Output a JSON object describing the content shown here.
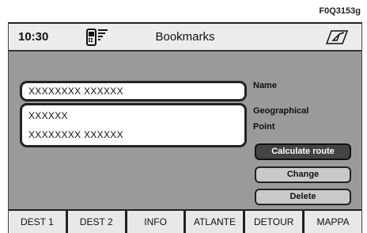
{
  "figure_code": "F0Q3153g",
  "header": {
    "time": "10:30",
    "title": "Bookmarks",
    "phone_icon": "phone-signal-icon",
    "nav_icon": "navigation-map-icon"
  },
  "fields": {
    "name_value": "XXXXXXXX XXXXXX",
    "address_line1": "XXXXXX",
    "address_line2": "XXXXXXXX XXXXXX"
  },
  "labels": {
    "name": "Name",
    "geographical": "Geographical",
    "point": "Point"
  },
  "buttons": {
    "calculate_route": "Calculate route",
    "change": "Change",
    "delete": "Delete"
  },
  "tabs": [
    "DEST 1",
    "DEST 2",
    "INFO",
    "ATLANTE",
    "DETOUR",
    "MAPPA"
  ],
  "colors": {
    "screen_bg": "#9a9a9a",
    "active_button": "#444444"
  }
}
